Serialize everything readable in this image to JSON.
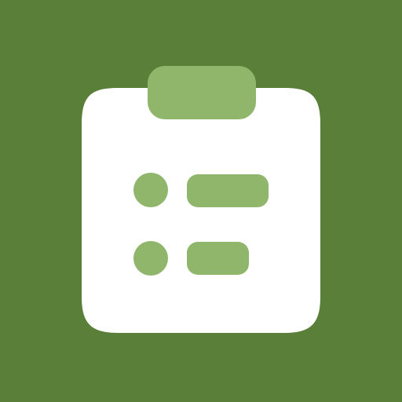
{
  "icon": {
    "name": "clipboard-checklist-icon",
    "colors": {
      "background": "#5a7f38",
      "board": "#ffffff",
      "accent": "#8fb66a"
    },
    "checklist_items": 2
  }
}
